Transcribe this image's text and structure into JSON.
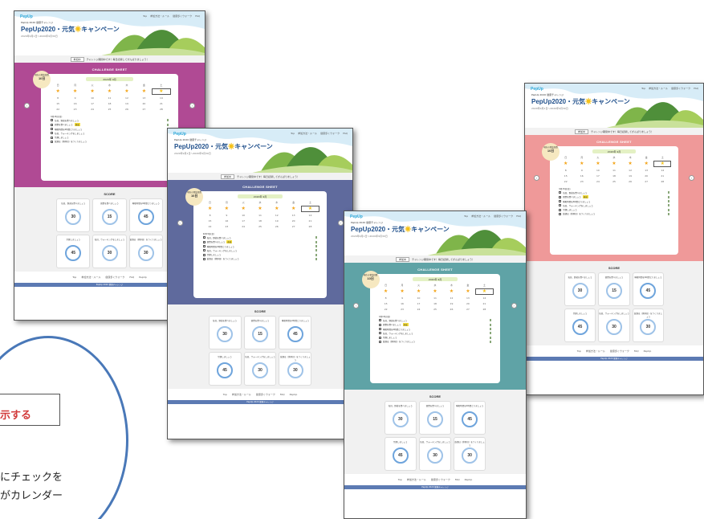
{
  "callout": {
    "heading": "示する",
    "line1": "にチェックを",
    "line2": "がカレンダー"
  },
  "site": {
    "logo": "PepUp",
    "subtitle": "PepUp 2020 健康チャレンジ",
    "title_pre": "PepUp2020・元気",
    "title_post": "キャンペーン",
    "period": "2020年9月1日〜2020年9月30日",
    "nav": [
      "Top",
      "参加方法・ルール",
      "健康歩くウォーク",
      "FAQ"
    ]
  },
  "notice": {
    "button": "参加中",
    "text": "チャレンジ期間中です！毎日記録してがんばりましょう！"
  },
  "sheet": {
    "title": "CHALLENGE SHEET",
    "bubble_label": "現在の参加日数",
    "bubble_value": "10日",
    "month": "2020年 9月",
    "weekdays": [
      "日",
      "月",
      "火",
      "水",
      "木",
      "金",
      "土"
    ],
    "rows": [
      [
        "★",
        "★",
        "★",
        "★",
        "★",
        "★",
        "★"
      ],
      [
        "8",
        "9",
        "10",
        "11",
        "12",
        "13",
        "14"
      ],
      [
        "15",
        "16",
        "17",
        "18",
        "19",
        "20",
        "21"
      ],
      [
        "22",
        "23",
        "24",
        "25",
        "26",
        "27",
        "28"
      ]
    ],
    "tasks_title": "9月15日(金)",
    "tasks": [
      {
        "label": "毎日、野菜を食べましょう",
        "tag": "",
        "checked": false
      },
      {
        "label": "朝食を食べましょう",
        "tag": "達成",
        "checked": true
      },
      {
        "label": "睡眠時間を6時間とりましょう",
        "tag": "",
        "checked": false
      },
      {
        "label": "毎日、ウォーキングをしましょう",
        "tag": "",
        "checked": false
      },
      {
        "label": "禁煙しましょう",
        "tag": "",
        "checked": false
      },
      {
        "label": "飲酒は（休肝日）をつくりましょう",
        "tag": "",
        "checked": false
      }
    ]
  },
  "score": {
    "title": "SCORE",
    "items": [
      {
        "label": "毎日、野菜を食べましょう",
        "value": "30"
      },
      {
        "label": "朝食を食べましょう",
        "value": "15"
      },
      {
        "label": "睡眠時間を6時間とりましょう",
        "value": "45"
      },
      {
        "label": "禁煙しましょう",
        "value": "45"
      },
      {
        "label": "毎日、ウォーキングをしましょう",
        "value": "30"
      },
      {
        "label": "飲酒は（休肝日）をつくりましょう",
        "value": "30"
      }
    ]
  },
  "footer": {
    "links": [
      "Top",
      "参加方法・ルール",
      "健康歩くウォーク",
      "FAQ",
      "PepUp"
    ],
    "copyright": "PepUp 2020 健康チャレンジ"
  },
  "colors": {
    "magenta": "#b04a94",
    "slate": "#5f6a9d",
    "teal": "#5fa3a6",
    "salmon": "#ef9999",
    "accent": "#4978b8"
  }
}
